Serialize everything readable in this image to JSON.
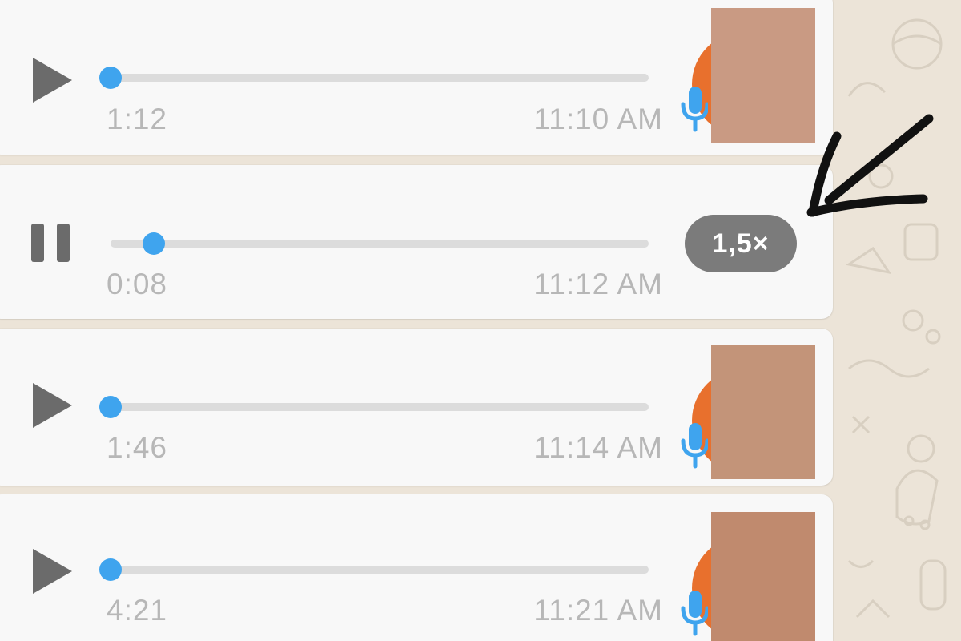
{
  "messages": [
    {
      "state": "paused",
      "duration": "1:12",
      "time": "11:10 AM",
      "progress": 0.0,
      "has_avatar": true,
      "avatar_color": "#c99a83"
    },
    {
      "state": "playing",
      "duration": "0:08",
      "time": "11:12 AM",
      "progress": 0.08,
      "speed_label": "1,5×"
    },
    {
      "state": "paused",
      "duration": "1:46",
      "time": "11:14 AM",
      "progress": 0.0,
      "has_avatar": true,
      "avatar_color": "#c39479"
    },
    {
      "state": "paused",
      "duration": "4:21",
      "time": "11:21 AM",
      "progress": 0.0,
      "has_avatar": true,
      "avatar_color": "#c08a6e"
    }
  ],
  "icons": {
    "play": "play-icon",
    "pause": "pause-icon",
    "mic": "microphone-icon",
    "annotation": "hand-drawn-arrow"
  },
  "colors": {
    "accent": "#3fa4ee",
    "track": "#dcdcdc",
    "meta_text": "#b7b7b7",
    "control": "#6b6b6b",
    "speed_pill": "#7b7b7b",
    "avatar_ring": "#e8702d",
    "chat_background": "#ece4d8",
    "bubble": "#f8f8f8"
  }
}
